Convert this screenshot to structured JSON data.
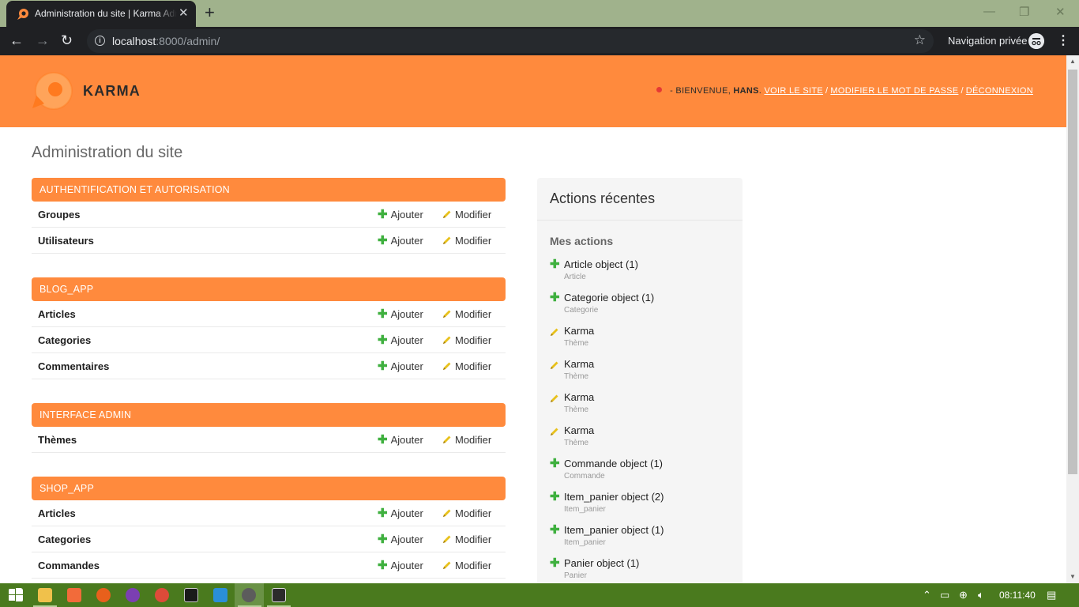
{
  "browser": {
    "tab_title": "Administration du site | Karma Admin",
    "new_tab": "+",
    "tab_close": "✕",
    "url_host": "localhost",
    "url_rest": ":8000/admin/",
    "incognito_label": "Navigation privée"
  },
  "header": {
    "brand": "KARMA",
    "welcome_prefix": "- BIENVENUE,",
    "username": "HANS",
    "view_site": "VOIR LE SITE",
    "change_password": "MODIFIER LE MOT DE PASSE",
    "logout": "DÉCONNEXION",
    "separator": "/"
  },
  "page_title": "Administration du site",
  "labels": {
    "add": "Ajouter",
    "change": "Modifier"
  },
  "modules": [
    {
      "caption": "Authentification et autorisation",
      "rows": [
        "Groupes",
        "Utilisateurs"
      ]
    },
    {
      "caption": "Blog_App",
      "rows": [
        "Articles",
        "Categories",
        "Commentaires"
      ]
    },
    {
      "caption": "Interface Admin",
      "rows": [
        "Thèmes"
      ]
    },
    {
      "caption": "Shop_App",
      "rows": [
        "Articles",
        "Categories",
        "Commandes"
      ]
    }
  ],
  "recent": {
    "title": "Actions récentes",
    "subtitle": "Mes actions",
    "items": [
      {
        "action": "add",
        "object": "Article object (1)",
        "type": "Article"
      },
      {
        "action": "add",
        "object": "Categorie object (1)",
        "type": "Categorie"
      },
      {
        "action": "change",
        "object": "Karma",
        "type": "Thème"
      },
      {
        "action": "change",
        "object": "Karma",
        "type": "Thème"
      },
      {
        "action": "change",
        "object": "Karma",
        "type": "Thème"
      },
      {
        "action": "change",
        "object": "Karma",
        "type": "Thème"
      },
      {
        "action": "add",
        "object": "Commande object (1)",
        "type": "Commande"
      },
      {
        "action": "add",
        "object": "Item_panier object (2)",
        "type": "Item_panier"
      },
      {
        "action": "add",
        "object": "Item_panier object (1)",
        "type": "Item_panier"
      },
      {
        "action": "add",
        "object": "Panier object (1)",
        "type": "Panier"
      }
    ]
  },
  "taskbar": {
    "clock": "08:11:40"
  },
  "colors": {
    "accent": "#ff8a3d",
    "add_green": "#3fb03f",
    "pencil_yellow": "#e8c11c",
    "taskbar": "#4a7a1e"
  }
}
